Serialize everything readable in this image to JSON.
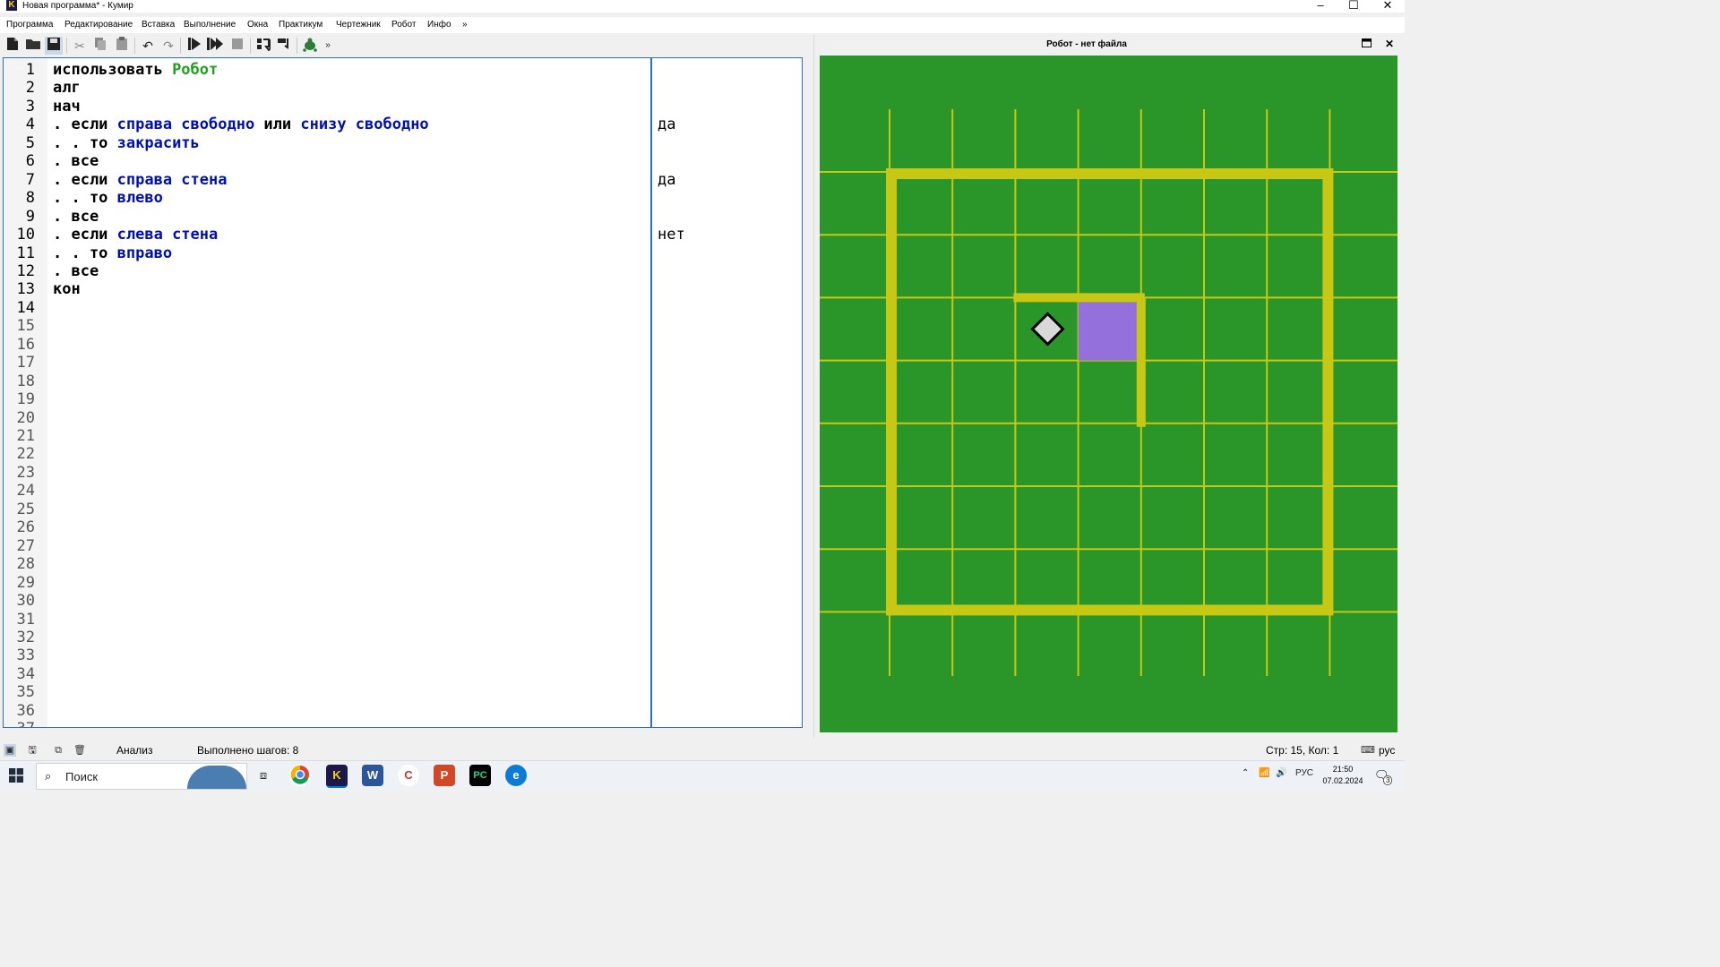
{
  "window": {
    "title": "Новая программа* - Кумир",
    "app_icon_letter": "K",
    "controls": [
      "–",
      "☐",
      "✕"
    ]
  },
  "menu": [
    "Программа",
    "Редактирование",
    "Вставка",
    "Выполнение",
    "Окна",
    "Практикум",
    "Чертежник",
    "Робот",
    "Инфо",
    "»"
  ],
  "toolbar": {
    "icons": [
      "new-file-icon",
      "open-folder-icon",
      "save-icon",
      "cut-icon",
      "copy-icon",
      "paste-icon",
      "undo-icon",
      "redo-icon",
      "run-icon",
      "run-step-icon",
      "stop-icon",
      "step-in-icon",
      "step-out-icon",
      "turtle-icon"
    ],
    "more_label": "»"
  },
  "editor": {
    "line_count": 37,
    "lines": [
      {
        "n": "1",
        "parts": [
          {
            "t": "использовать ",
            "c": "kw"
          },
          {
            "t": "Робот",
            "c": "mod"
          }
        ],
        "result": ""
      },
      {
        "n": "2",
        "parts": [
          {
            "t": "алг",
            "c": "kw"
          }
        ],
        "result": ""
      },
      {
        "n": "3",
        "parts": [
          {
            "t": "нач",
            "c": "kw"
          }
        ],
        "result": ""
      },
      {
        "n": "4",
        "parts": [
          {
            "t": ". если ",
            "c": "kw"
          },
          {
            "t": "справа свободно",
            "c": "cmd"
          },
          {
            "t": " или ",
            "c": "kw"
          },
          {
            "t": "снизу свободно",
            "c": "cmd"
          }
        ],
        "result": "да"
      },
      {
        "n": "5",
        "parts": [
          {
            "t": ". . то ",
            "c": "kw"
          },
          {
            "t": "закрасить",
            "c": "cmd"
          }
        ],
        "result": ""
      },
      {
        "n": "6",
        "parts": [
          {
            "t": ". все",
            "c": "kw"
          }
        ],
        "result": ""
      },
      {
        "n": "7",
        "parts": [
          {
            "t": ". если ",
            "c": "kw"
          },
          {
            "t": "справа стена",
            "c": "cmd"
          }
        ],
        "result": "да"
      },
      {
        "n": "8",
        "parts": [
          {
            "t": ". . то ",
            "c": "kw"
          },
          {
            "t": "влево",
            "c": "cmd"
          }
        ],
        "result": ""
      },
      {
        "n": "9",
        "parts": [
          {
            "t": ". все",
            "c": "kw"
          }
        ],
        "result": ""
      },
      {
        "n": "10",
        "parts": [
          {
            "t": ". если ",
            "c": "kw"
          },
          {
            "t": "слева стена",
            "c": "cmd"
          }
        ],
        "result": "нет"
      },
      {
        "n": "11",
        "parts": [
          {
            "t": ". . то ",
            "c": "kw"
          },
          {
            "t": "вправо",
            "c": "cmd"
          }
        ],
        "result": ""
      },
      {
        "n": "12",
        "parts": [
          {
            "t": ". все",
            "c": "kw"
          }
        ],
        "result": ""
      },
      {
        "n": "13",
        "parts": [
          {
            "t": "кон",
            "c": "kw"
          }
        ],
        "result": ""
      }
    ]
  },
  "robot_panel": {
    "title": "Робот - нет файла",
    "field_color": "#2a962a",
    "grid_color": "#c8c814",
    "wall_color": "#c8c814",
    "painted_color": "#9370db",
    "robot": "diamond-robot"
  },
  "status": {
    "analysis": "Анализ",
    "steps": "Выполнено шагов: 8",
    "position": "Стр: 15, Кол: 1",
    "lang": "рус"
  },
  "taskbar": {
    "search_placeholder": "Поиск",
    "lang": "РУС",
    "time": "21:50",
    "date": "07.02.2024",
    "notif_count": "3"
  }
}
